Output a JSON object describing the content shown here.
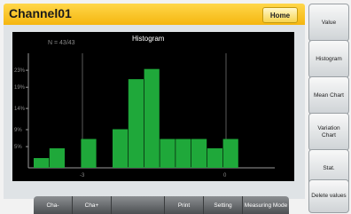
{
  "header": {
    "title": "Channel01",
    "home_label": "Home"
  },
  "histogram": {
    "title": "Histogram",
    "sample_text": "N = 43/43",
    "y_tick_labels": [
      "23%",
      "19%",
      "14%",
      "9%",
      "5%"
    ],
    "x_tick_labels": [
      "-3",
      "0"
    ],
    "bar_color": "#1fa83a"
  },
  "chart_data": {
    "type": "bar",
    "title": "Histogram",
    "annotation": "N = 43/43",
    "ylim": [
      0,
      27
    ],
    "yticks": [
      5,
      9,
      14,
      19,
      23
    ],
    "xticks": [
      "-3",
      "0"
    ],
    "values": [
      2.3,
      4.6,
      0,
      6.8,
      0,
      9.1,
      20.9,
      23.3,
      6.8,
      6.8,
      6.8,
      4.6,
      6.8
    ],
    "grid": false
  },
  "sidebar": {
    "buttons": [
      "Value",
      "Histogram",
      "Mean Chart",
      "Variation Chart",
      "Stat.",
      "Delete values"
    ]
  },
  "toolbar": {
    "buttons": [
      "Cha-",
      "Cha+",
      "",
      "Print",
      "Setting",
      "Measuring Mode"
    ]
  },
  "colors": {
    "title_bar": "#f5b60f",
    "chart_bg": "#000000",
    "bars": "#1fa83a"
  }
}
